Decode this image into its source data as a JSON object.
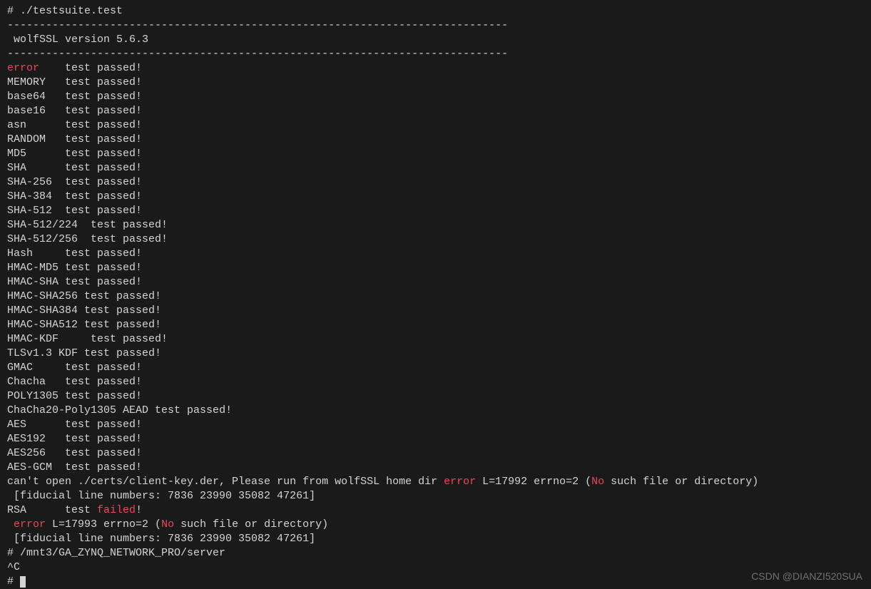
{
  "prompt1": "# ",
  "command1": "./testsuite.test",
  "separator": "------------------------------------------------------------------------------",
  "version_line": " wolfSSL version 5.6.3",
  "tests": [
    {
      "name": "error",
      "pad": "   ",
      "result": "test passed!",
      "nameClass": "error"
    },
    {
      "name": "MEMORY",
      "pad": "  ",
      "result": "test passed!"
    },
    {
      "name": "base64",
      "pad": "  ",
      "result": "test passed!"
    },
    {
      "name": "base16",
      "pad": "  ",
      "result": "test passed!"
    },
    {
      "name": "asn",
      "pad": "     ",
      "result": "test passed!"
    },
    {
      "name": "RANDOM",
      "pad": "  ",
      "result": "test passed!"
    },
    {
      "name": "MD5",
      "pad": "     ",
      "result": "test passed!"
    },
    {
      "name": "SHA",
      "pad": "     ",
      "result": "test passed!"
    },
    {
      "name": "SHA-256",
      "pad": " ",
      "result": "test passed!"
    },
    {
      "name": "SHA-384",
      "pad": " ",
      "result": "test passed!"
    },
    {
      "name": "SHA-512",
      "pad": " ",
      "result": "test passed!"
    },
    {
      "name": "SHA-512/224",
      "pad": " ",
      "result": "test passed!"
    },
    {
      "name": "SHA-512/256",
      "pad": " ",
      "result": "test passed!"
    },
    {
      "name": "Hash",
      "pad": "    ",
      "result": "test passed!"
    },
    {
      "name": "HMAC-MD5",
      "pad": "",
      "result": "test passed!"
    },
    {
      "name": "HMAC-SHA",
      "pad": "",
      "result": "test passed!"
    },
    {
      "name": "HMAC-SHA256",
      "pad": "",
      "result": "test passed!"
    },
    {
      "name": "HMAC-SHA384",
      "pad": "",
      "result": "test passed!"
    },
    {
      "name": "HMAC-SHA512",
      "pad": "",
      "result": "test passed!"
    },
    {
      "name": "HMAC-KDF",
      "pad": "    ",
      "result": "test passed!"
    },
    {
      "name": "TLSv1.3 KDF",
      "pad": "",
      "result": "test passed!"
    },
    {
      "name": "GMAC",
      "pad": "    ",
      "result": "test passed!"
    },
    {
      "name": "Chacha",
      "pad": "  ",
      "result": "test passed!"
    },
    {
      "name": "POLY1305",
      "pad": "",
      "result": "test passed!"
    },
    {
      "name": "ChaCha20-Poly1305 AEAD",
      "pad": "",
      "result": "test passed!"
    },
    {
      "name": "AES",
      "pad": "     ",
      "result": "test passed!"
    },
    {
      "name": "AES192",
      "pad": "  ",
      "result": "test passed!"
    },
    {
      "name": "AES256",
      "pad": "  ",
      "result": "test passed!"
    },
    {
      "name": "AES-GCM",
      "pad": " ",
      "result": "test passed!"
    }
  ],
  "error_line1_part1": "can't open ./certs/client-key.der, Please run from wolfSSL home dir ",
  "error_line1_error": "error",
  "error_line1_part2": " L=17992 errno=2 (",
  "error_line1_no": "No",
  "error_line1_part3": " such file or directory)",
  "fiducial_line": " [fiducial line numbers: 7836 23990 35082 47261]",
  "rsa_name": "RSA",
  "rsa_pad": "     ",
  "rsa_test": "test ",
  "rsa_failed": "failed",
  "rsa_excl": "!",
  "error_line2_space": " ",
  "error_line2_error": "error",
  "error_line2_part1": " L=17993 errno=2 (",
  "error_line2_no": "No",
  "error_line2_part2": " such file or directory)",
  "prompt2": "# ",
  "command2": "/mnt3/GA_ZYNQ_NETWORK_PRO/server",
  "ctrlc": "^C",
  "prompt3": "# ",
  "watermark": "CSDN @DIANZI520SUA"
}
